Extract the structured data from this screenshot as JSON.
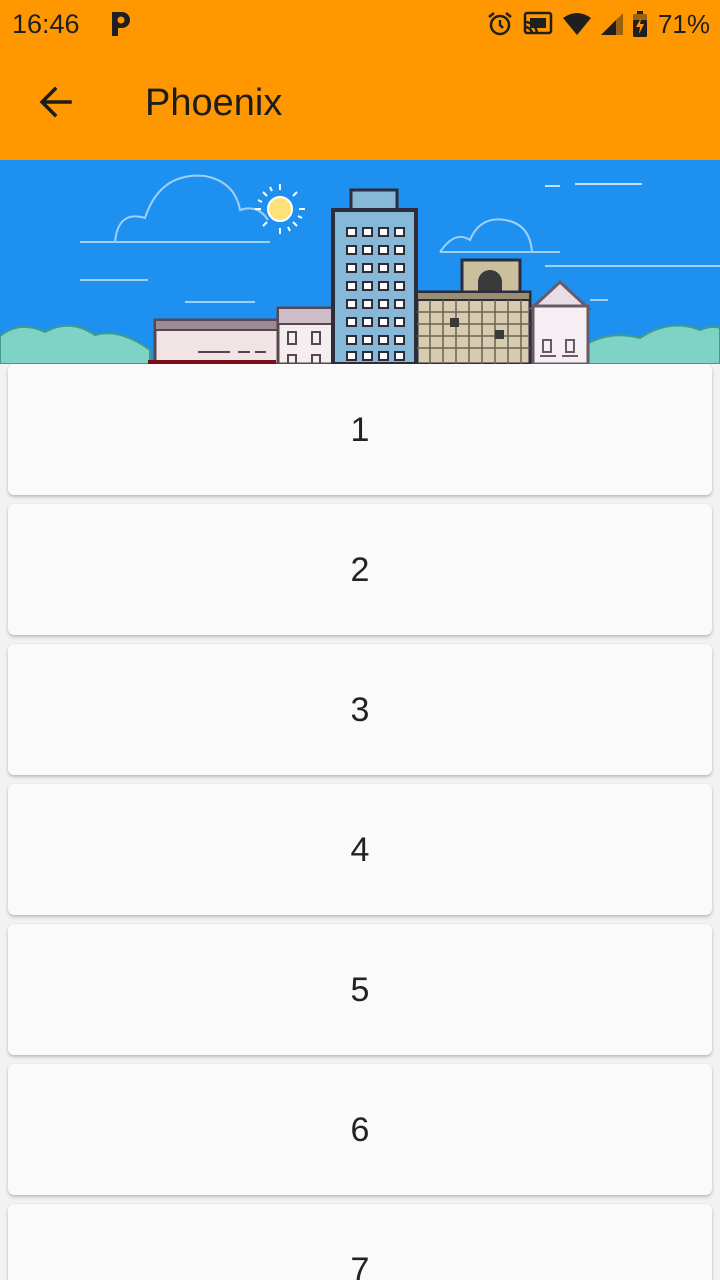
{
  "status_bar": {
    "time": "16:46",
    "battery_percent": "71%",
    "icons": [
      "app-p-icon",
      "alarm-icon",
      "cast-icon",
      "wifi-icon",
      "cell-signal-icon",
      "battery-charging-icon"
    ]
  },
  "app_bar": {
    "back_icon": "arrow-left-icon",
    "title": "Phoenix",
    "background_color": "#ff9800"
  },
  "header": {
    "image": "city-skyline-illustration",
    "sky_color": "#1e90f0"
  },
  "list": {
    "items": [
      "1",
      "2",
      "3",
      "4",
      "5",
      "6",
      "7"
    ]
  }
}
